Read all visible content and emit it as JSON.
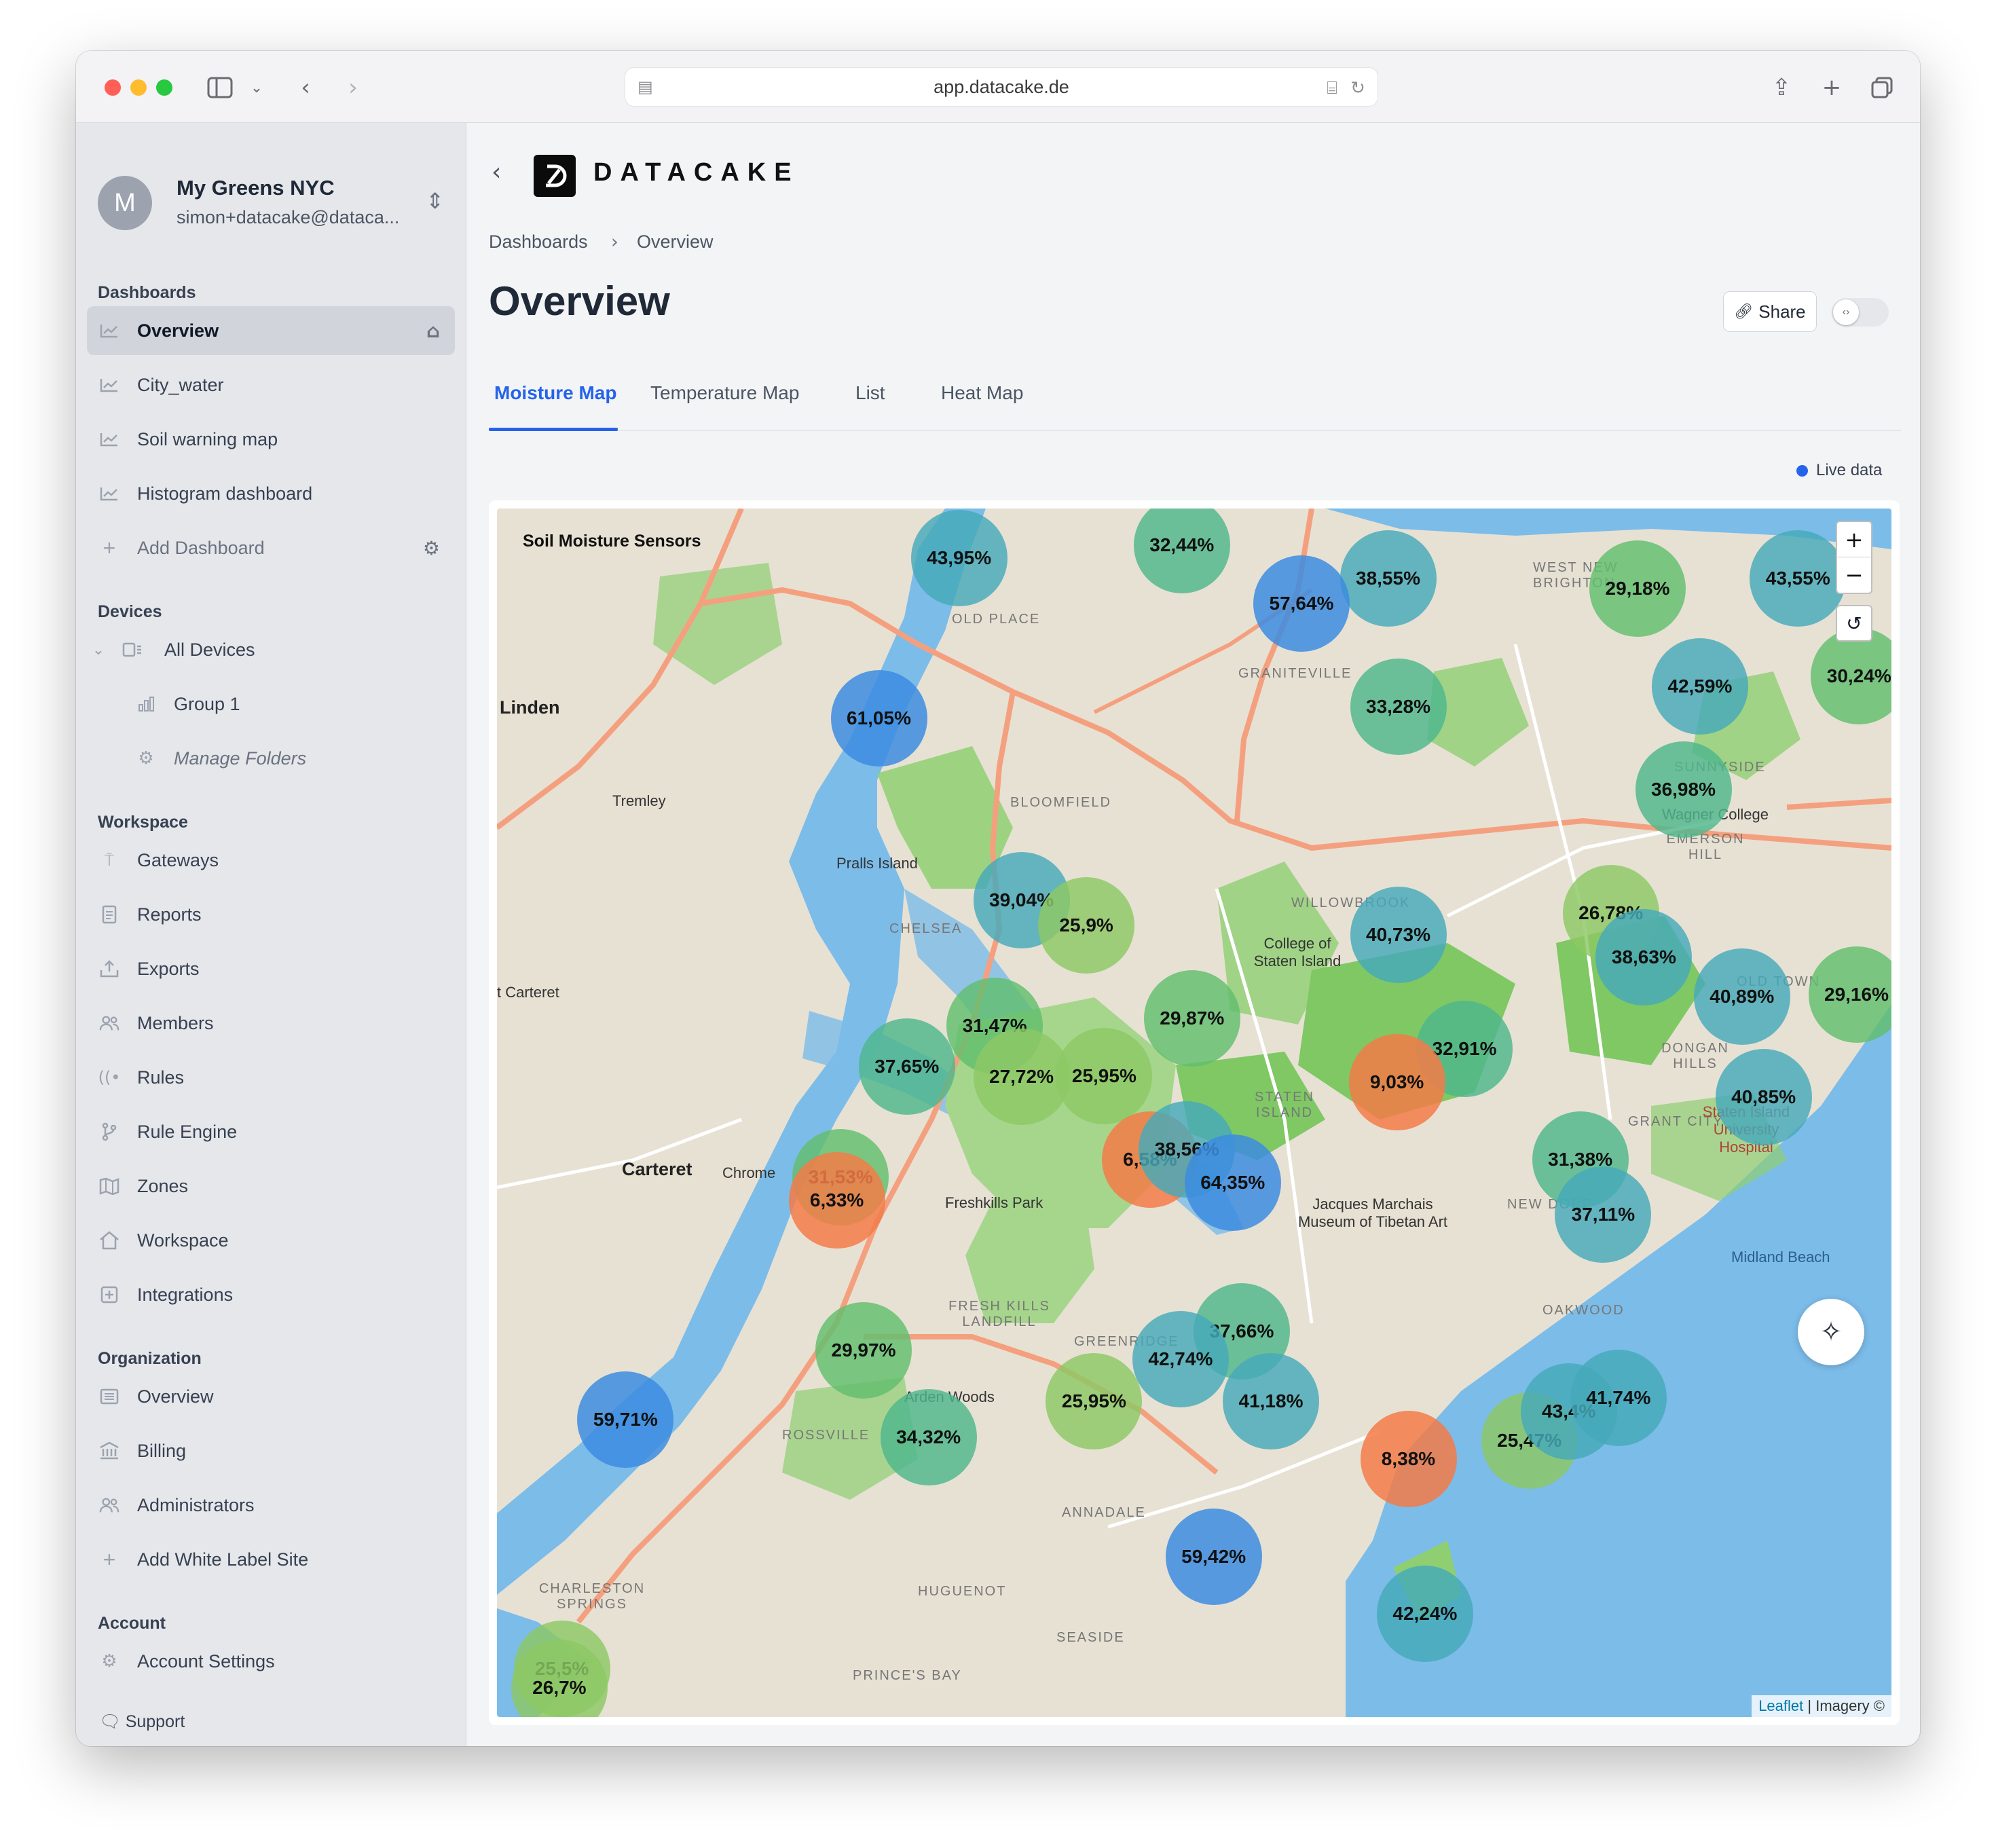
{
  "browser": {
    "url": "app.datacake.de"
  },
  "sidebar": {
    "org_initial": "M",
    "org_name": "My Greens NYC",
    "org_email": "simon+datacake@dataca...",
    "sections": {
      "dashboards": "Dashboards",
      "devices": "Devices",
      "workspace": "Workspace",
      "organization": "Organization",
      "account": "Account"
    },
    "dashboards": [
      {
        "label": "Overview",
        "icon": "chart-line-icon"
      },
      {
        "label": "City_water",
        "icon": "chart-line-icon"
      },
      {
        "label": "Soil warning map",
        "icon": "chart-line-icon"
      },
      {
        "label": "Histogram dashboard",
        "icon": "chart-line-icon"
      },
      {
        "label": "Add Dashboard",
        "icon": "plus-icon"
      }
    ],
    "devices": [
      {
        "label": "All Devices",
        "icon": "device-list-icon"
      },
      {
        "label": "Group 1",
        "icon": "bar-chart-icon"
      },
      {
        "label": "Manage Folders",
        "icon": "gear-icon"
      }
    ],
    "workspace": [
      {
        "label": "Gateways",
        "icon": "antenna-icon"
      },
      {
        "label": "Reports",
        "icon": "document-icon"
      },
      {
        "label": "Exports",
        "icon": "export-icon"
      },
      {
        "label": "Members",
        "icon": "users-icon"
      },
      {
        "label": "Rules",
        "icon": "signal-icon"
      },
      {
        "label": "Rule Engine",
        "icon": "branch-icon"
      },
      {
        "label": "Zones",
        "icon": "map-icon"
      },
      {
        "label": "Workspace",
        "icon": "home-icon"
      },
      {
        "label": "Integrations",
        "icon": "plus-box-icon"
      }
    ],
    "organization": [
      {
        "label": "Overview",
        "icon": "list-icon"
      },
      {
        "label": "Billing",
        "icon": "bank-icon"
      },
      {
        "label": "Administrators",
        "icon": "users-icon"
      },
      {
        "label": "Add White Label Site",
        "icon": "plus-icon"
      }
    ],
    "account": [
      {
        "label": "Account Settings",
        "icon": "gear-icon"
      }
    ],
    "support": "Support"
  },
  "header": {
    "brand": "DATACAKE",
    "breadcrumb": [
      "Dashboards",
      "Overview"
    ],
    "title": "Overview",
    "share_label": "Share"
  },
  "tabs": [
    {
      "label": "Moisture Map",
      "active": true
    },
    {
      "label": "Temperature Map",
      "active": false
    },
    {
      "label": "List",
      "active": false
    },
    {
      "label": "Heat Map",
      "active": false
    }
  ],
  "live_label": "Live data",
  "map": {
    "title": "Soil Moisture Sensors",
    "zoom_in": "+",
    "zoom_out": "−",
    "attribution_link": "Leaflet",
    "attribution_text": "| Imagery ©",
    "colors": {
      "water": "#7cbce9",
      "land": "#e7e1d4",
      "park": "#8fcf72",
      "road": "#f4a07f",
      "dry": "#f27d4d",
      "mid": "#5cbf8e",
      "wet": "#3f8fe0"
    },
    "places": [
      "Linden",
      "Tremley",
      "Carteret",
      "Chrome",
      "t Carteret",
      "Pralls Island",
      "CHELSEA",
      "BLOOMFIELD",
      "GRANITEVILLE",
      "OLD PLACE",
      "Freshkills Park",
      "College of Staten Island",
      "Jacques Marchais Museum of Tibetan Art",
      "Arden Woods",
      "ROSSVILLE",
      "GREENRIDGE",
      "ANNADALE",
      "HUGUENOT",
      "SEASIDE",
      "PRINCE'S BAY",
      "CHARLESTON SPRINGS",
      "OAKWOOD",
      "Midland Beach",
      "STATEN ISLAND",
      "WEST NEW BRIGHTON",
      "Wagner College",
      "EMERSON HILL",
      "DONGAN HILLS",
      "GRANT CITY",
      "Staten Island University Hospital",
      "FRESH KILLS LANDFILL",
      "WILLOWBROOK",
      "SUNNYSIDE",
      "OLD TOWN",
      "NEW DORP"
    ],
    "sensors": [
      {
        "value": "43,95",
        "level": "mid-blue"
      },
      {
        "value": "32,44",
        "level": "mid"
      },
      {
        "value": "38,55",
        "level": "mid-blue"
      },
      {
        "value": "57,64",
        "level": "wet"
      },
      {
        "value": "29,18",
        "level": "mid-green"
      },
      {
        "value": "43,55",
        "level": "mid-blue"
      },
      {
        "value": "61,05",
        "level": "wet"
      },
      {
        "value": "33,28",
        "level": "mid"
      },
      {
        "value": "42,59",
        "level": "mid-blue"
      },
      {
        "value": "30,24",
        "level": "mid-green"
      },
      {
        "value": "36,98",
        "level": "mid"
      },
      {
        "value": "39,04",
        "level": "mid-blue"
      },
      {
        "value": "25,9",
        "level": "green"
      },
      {
        "value": "40,73",
        "level": "mid-blue"
      },
      {
        "value": "26,78",
        "level": "green"
      },
      {
        "value": "38,63",
        "level": "mid-blue"
      },
      {
        "value": "40,89",
        "level": "mid-blue"
      },
      {
        "value": "29,16",
        "level": "mid-green"
      },
      {
        "value": "31,47",
        "level": "mid-green"
      },
      {
        "value": "29,87",
        "level": "mid-green"
      },
      {
        "value": "37,65",
        "level": "mid"
      },
      {
        "value": "27,72",
        "level": "green"
      },
      {
        "value": "25,95",
        "level": "green"
      },
      {
        "value": "32,91",
        "level": "mid"
      },
      {
        "value": "9,03",
        "level": "dry"
      },
      {
        "value": "40,85",
        "level": "mid-blue"
      },
      {
        "value": "6,58",
        "level": "dry"
      },
      {
        "value": "38,56",
        "level": "mid-blue"
      },
      {
        "value": "64,35",
        "level": "wet"
      },
      {
        "value": "31,53",
        "level": "mid-green"
      },
      {
        "value": "6,33",
        "level": "dry"
      },
      {
        "value": "31,38",
        "level": "mid"
      },
      {
        "value": "37,11",
        "level": "mid-blue"
      },
      {
        "value": "29,97",
        "level": "mid-green"
      },
      {
        "value": "37,66",
        "level": "mid"
      },
      {
        "value": "42,74",
        "level": "mid-blue"
      },
      {
        "value": "59,71",
        "level": "wet"
      },
      {
        "value": "34,32",
        "level": "mid"
      },
      {
        "value": "25,95",
        "level": "green"
      },
      {
        "value": "41,18",
        "level": "mid-blue"
      },
      {
        "value": "8,38",
        "level": "dry"
      },
      {
        "value": "25,47",
        "level": "green"
      },
      {
        "value": "43,4",
        "level": "mid-blue"
      },
      {
        "value": "41,74",
        "level": "mid-blue"
      },
      {
        "value": "59,42",
        "level": "wet"
      },
      {
        "value": "42,24",
        "level": "mid-blue"
      },
      {
        "value": "25,5",
        "level": "green"
      },
      {
        "value": "26,7",
        "level": "green"
      }
    ]
  }
}
